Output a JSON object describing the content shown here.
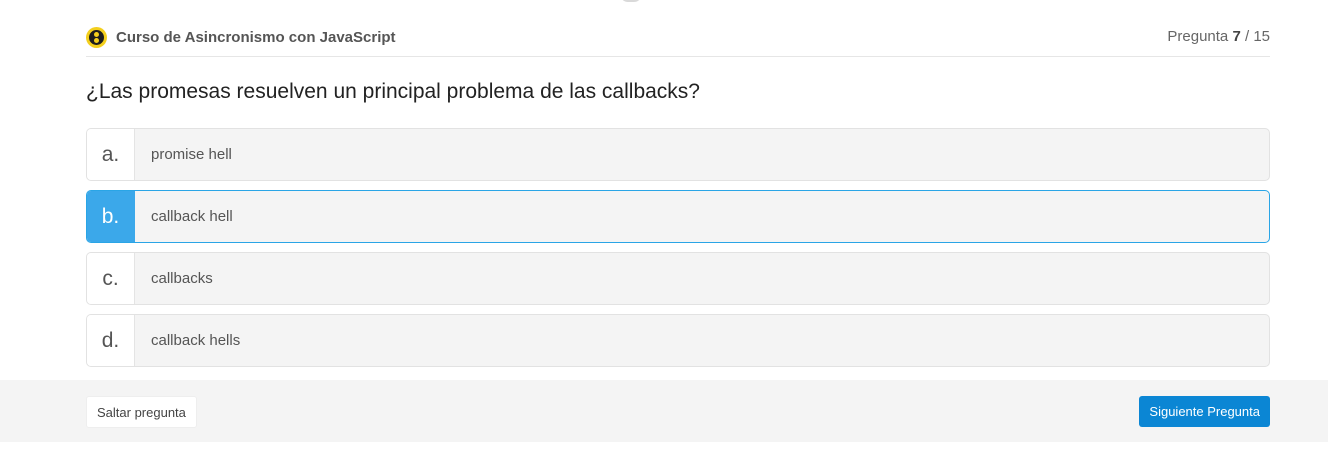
{
  "header": {
    "course_name": "Curso de Asincronismo con JavaScript",
    "progress_label": "Pregunta",
    "current_question": "7",
    "total_questions": "15"
  },
  "question": {
    "text": "¿Las promesas resuelven un principal problema de las callbacks?"
  },
  "options": [
    {
      "letter": "a.",
      "text": "promise hell",
      "selected": false
    },
    {
      "letter": "b.",
      "text": "callback hell",
      "selected": true
    },
    {
      "letter": "c.",
      "text": "callbacks",
      "selected": false
    },
    {
      "letter": "d.",
      "text": "callback hells",
      "selected": false
    }
  ],
  "footer": {
    "skip_label": "Saltar pregunta",
    "next_label": "Siguiente Pregunta"
  },
  "colors": {
    "accent": "#3ba8ea",
    "next_button": "#0b86d4",
    "logo": "#f3cf1d"
  }
}
